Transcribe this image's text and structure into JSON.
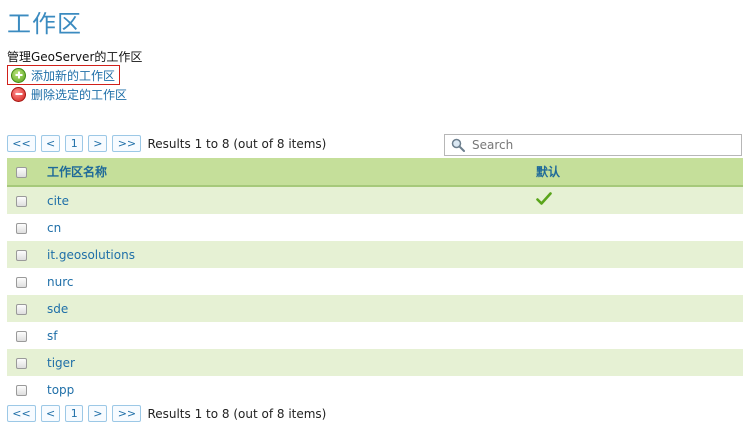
{
  "page": {
    "title": "工作区",
    "description": "管理GeoServer的工作区"
  },
  "actions": {
    "add_label": "添加新的工作区",
    "remove_label": "删除选定的工作区"
  },
  "pager": {
    "first": "<<",
    "prev": "<",
    "current": "1",
    "next": ">",
    "last": ">>",
    "info": "Results 1 to 8 (out of 8 items)"
  },
  "search": {
    "placeholder": "Search",
    "value": ""
  },
  "table": {
    "headers": {
      "name": "工作区名称",
      "default": "默认"
    },
    "rows": [
      {
        "name": "cite",
        "default": true
      },
      {
        "name": "cn",
        "default": false
      },
      {
        "name": "it.geosolutions",
        "default": false
      },
      {
        "name": "nurc",
        "default": false
      },
      {
        "name": "sde",
        "default": false
      },
      {
        "name": "sf",
        "default": false
      },
      {
        "name": "tiger",
        "default": false
      },
      {
        "name": "topp",
        "default": false
      }
    ]
  },
  "colors": {
    "title": "#3b8bc0",
    "link": "#1f6fa8",
    "header_bg": "#c5df9a",
    "row_alt_bg": "#e6f1d4",
    "add_highlight_border": "#d0201a",
    "check": "#5aa51b"
  },
  "icons": {
    "add": "plus-circle-icon",
    "remove": "minus-circle-icon",
    "search": "search-icon",
    "default_marker": "checkmark-icon"
  }
}
